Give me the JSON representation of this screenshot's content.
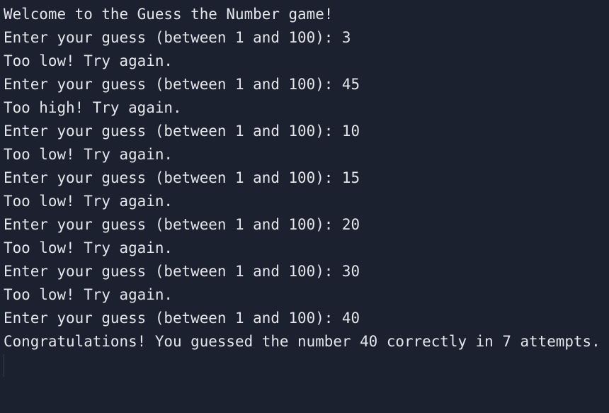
{
  "terminal": {
    "lines": [
      "Welcome to the Guess the Number game!",
      "Enter your guess (between 1 and 100): 3",
      "Too low! Try again.",
      "Enter your guess (between 1 and 100): 45",
      "Too high! Try again.",
      "Enter your guess (between 1 and 100): 10",
      "Too low! Try again.",
      "Enter your guess (between 1 and 100): 15",
      "Too low! Try again.",
      "Enter your guess (between 1 and 100): 20",
      "Too low! Try again.",
      "Enter your guess (between 1 and 100): 30",
      "Too low! Try again.",
      "Enter your guess (between 1 and 100): 40",
      "Congratulations! You guessed the number 40 correctly in 7 attempts."
    ],
    "colors": {
      "background": "#1c2130",
      "text": "#e4e6ea"
    }
  }
}
